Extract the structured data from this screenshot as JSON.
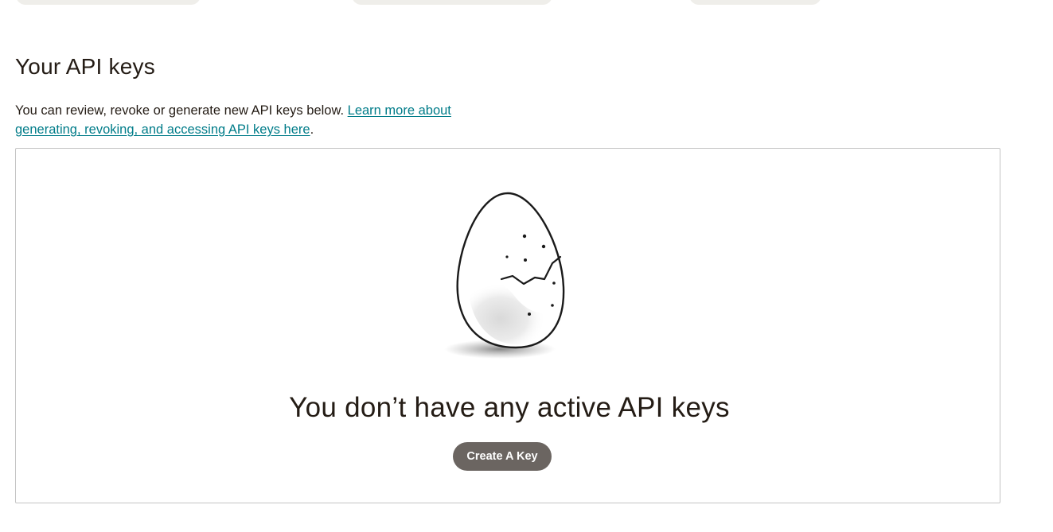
{
  "section": {
    "title": "Your API keys",
    "intro_text": "You can review, revoke or generate new API keys below. ",
    "intro_link": "Learn more about generating, revoking, and accessing API keys here",
    "intro_end": "."
  },
  "empty_state": {
    "illustration": "cracked-egg-illustration",
    "title": "You don’t have any active API keys",
    "button_label": "Create A Key"
  },
  "colors": {
    "link": "#007c89",
    "button_bg": "#6b6561",
    "text": "#241c15",
    "border": "#c4c4c4"
  }
}
